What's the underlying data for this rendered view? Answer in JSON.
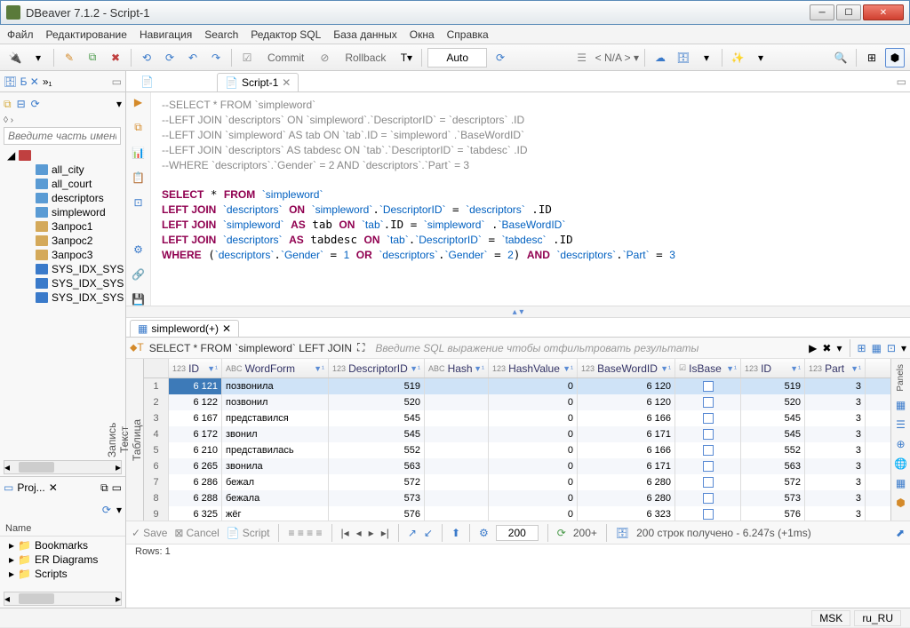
{
  "window": {
    "title": "DBeaver 7.1.2 -            Script-1"
  },
  "menu": [
    "Файл",
    "Редактирование",
    "Навигация",
    "Search",
    "Редактор SQL",
    "База данных",
    "Окна",
    "Справка"
  ],
  "toolbar": {
    "commit": "Commit",
    "rollback": "Rollback",
    "auto": "Auto",
    "na": "N/A"
  },
  "nav": {
    "filter_placeholder": "Введите часть имени та",
    "items": [
      "all_city",
      "all_court",
      "descriptors",
      "simpleword",
      "Запрос1",
      "Запрос2",
      "Запрос3",
      "SYS_IDX_SYS_P",
      "SYS_IDX_SYS_P",
      "SYS_IDX_SYS_P"
    ]
  },
  "projects": {
    "title": "Proj...",
    "name_col": "Name",
    "items": [
      "Bookmarks",
      "ER Diagrams",
      "Scripts"
    ]
  },
  "editor": {
    "tab": "Script-1",
    "comment_lines": [
      "--SELECT * FROM `simpleword`",
      "--LEFT JOIN `descriptors` ON `simpleword`.`DescriptorID` = `descriptors` .ID",
      "--LEFT JOIN `simpleword` AS tab ON `tab`.ID = `simpleword` .`BaseWordID`",
      "--LEFT JOIN `descriptors` AS tabdesc ON `tab`.`DescriptorID` = `tabdesc` .ID",
      "--WHERE `descriptors`.`Gender` = 2 AND `descriptors`.`Part` = 3"
    ]
  },
  "result": {
    "tab": "simpleword(+)",
    "sql_preview": "SELECT * FROM `simpleword` LEFT JOIN",
    "filter_hint": "Введите SQL выражение чтобы отфильтровать результаты",
    "columns": [
      "",
      "ID",
      "WordForm",
      "DescriptorID",
      "Hash",
      "HashValue",
      "BaseWordID",
      "IsBase",
      "ID",
      "Part"
    ],
    "side_labels": [
      "Таблица",
      "Текст",
      "Запись"
    ],
    "rows": [
      {
        "n": 1,
        "id": 6121,
        "word": "позвонила",
        "desc": 519,
        "hash": "",
        "hv": 0,
        "bw": 6120,
        "ib": false,
        "id2": 519,
        "part": 3
      },
      {
        "n": 2,
        "id": 6122,
        "word": "позвонил",
        "desc": 520,
        "hash": "",
        "hv": 0,
        "bw": 6120,
        "ib": false,
        "id2": 520,
        "part": 3
      },
      {
        "n": 3,
        "id": 6167,
        "word": "представился",
        "desc": 545,
        "hash": "",
        "hv": 0,
        "bw": 6166,
        "ib": false,
        "id2": 545,
        "part": 3
      },
      {
        "n": 4,
        "id": 6172,
        "word": "звонил",
        "desc": 545,
        "hash": "",
        "hv": 0,
        "bw": 6171,
        "ib": false,
        "id2": 545,
        "part": 3
      },
      {
        "n": 5,
        "id": 6210,
        "word": "представилась",
        "desc": 552,
        "hash": "",
        "hv": 0,
        "bw": 6166,
        "ib": false,
        "id2": 552,
        "part": 3
      },
      {
        "n": 6,
        "id": 6265,
        "word": "звонила",
        "desc": 563,
        "hash": "",
        "hv": 0,
        "bw": 6171,
        "ib": false,
        "id2": 563,
        "part": 3
      },
      {
        "n": 7,
        "id": 6286,
        "word": "бежал",
        "desc": 572,
        "hash": "",
        "hv": 0,
        "bw": 6280,
        "ib": false,
        "id2": 572,
        "part": 3
      },
      {
        "n": 8,
        "id": 6288,
        "word": "бежала",
        "desc": 573,
        "hash": "",
        "hv": 0,
        "bw": 6280,
        "ib": false,
        "id2": 573,
        "part": 3
      },
      {
        "n": 9,
        "id": 6325,
        "word": "жёг",
        "desc": 576,
        "hash": "",
        "hv": 0,
        "bw": 6323,
        "ib": false,
        "id2": 576,
        "part": 3
      }
    ],
    "footer": {
      "save": "Save",
      "cancel": "Cancel",
      "script": "Script",
      "page_size": "200",
      "fetch_size": "200+",
      "status": "200 строк получено - 6.247s (+1ms)"
    },
    "rows_label": "Rows: 1"
  },
  "statusbar": {
    "tz": "MSK",
    "locale": "ru_RU"
  }
}
